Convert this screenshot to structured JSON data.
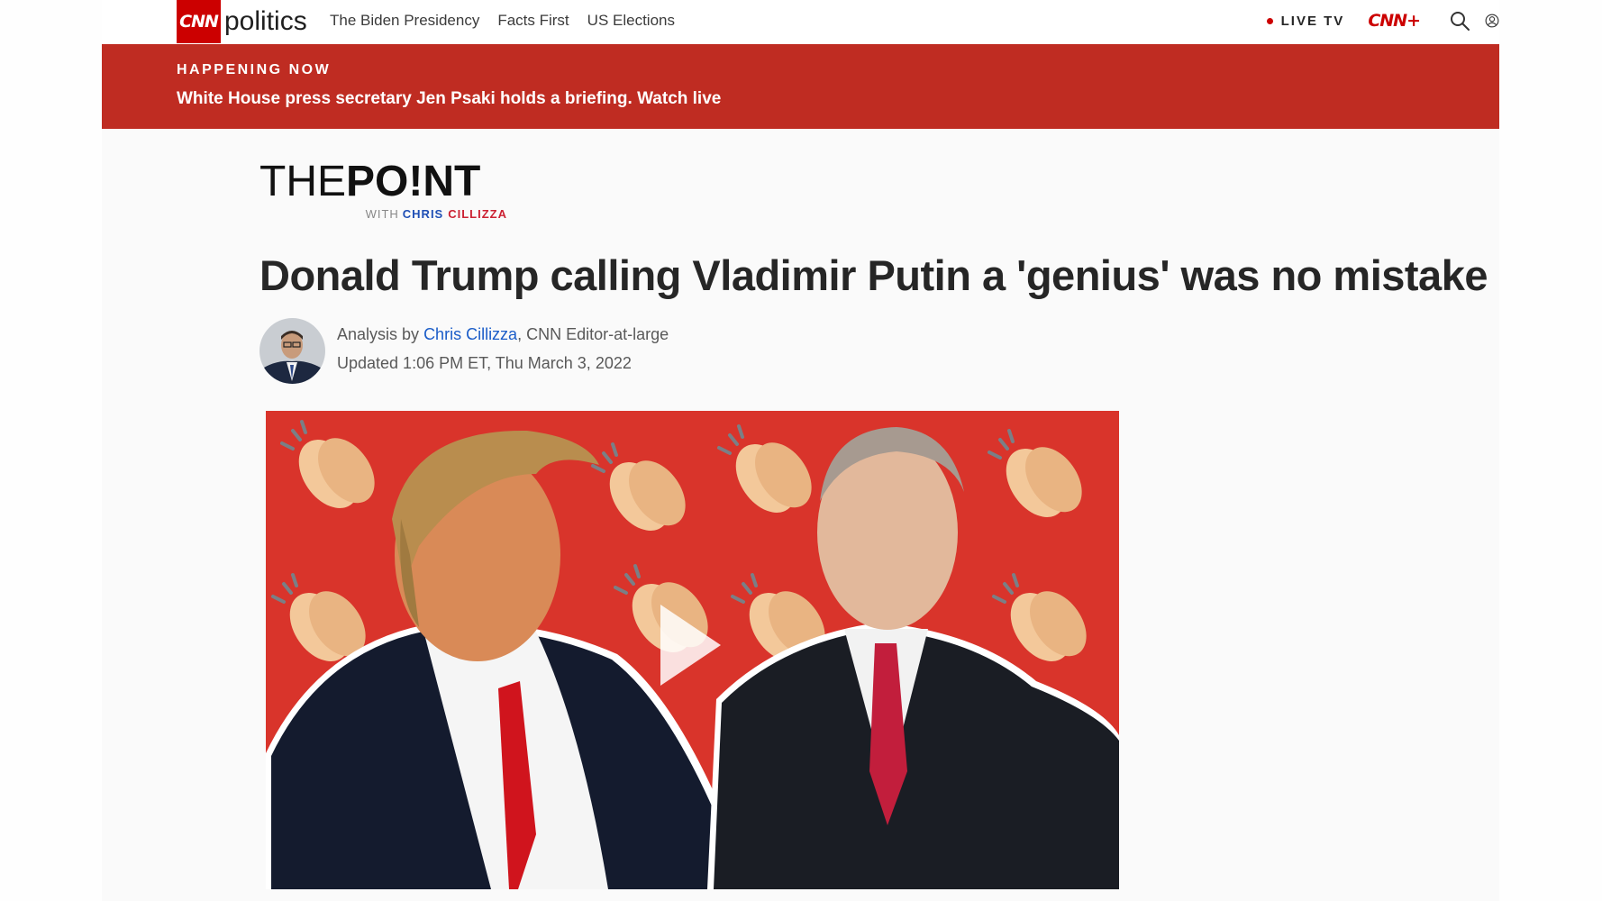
{
  "nav": {
    "logo": "CNN",
    "section": "politics",
    "links": [
      "The Biden Presidency",
      "Facts First",
      "US Elections"
    ],
    "live_tv": "LIVE TV",
    "cnn_plus": "CNN+",
    "icons": [
      "search-icon",
      "user-icon"
    ]
  },
  "banner": {
    "kicker": "HAPPENING NOW",
    "text": "White House press secretary Jen Psaki holds a briefing. Watch live"
  },
  "column": {
    "title_light": "THE",
    "title_bold": "PO!NT",
    "with": "WITH",
    "author_first": "CHRIS",
    "author_last": "CILLIZZA"
  },
  "article": {
    "headline": "Donald Trump calling Vladimir Putin a 'genius' was no mistake",
    "analysis_prefix": "Analysis by",
    "author": "Chris Cillizza",
    "author_role": ", CNN Editor-at-large",
    "updated": "Updated 1:06 PM ET, Thu March 3, 2022"
  },
  "hero": {
    "kind": "video",
    "icon": "play-icon",
    "background_color": "#d9342b"
  },
  "colors": {
    "cnn_red": "#cc0000",
    "banner_red": "#bf2c22",
    "link_blue": "#1a5cc8"
  }
}
